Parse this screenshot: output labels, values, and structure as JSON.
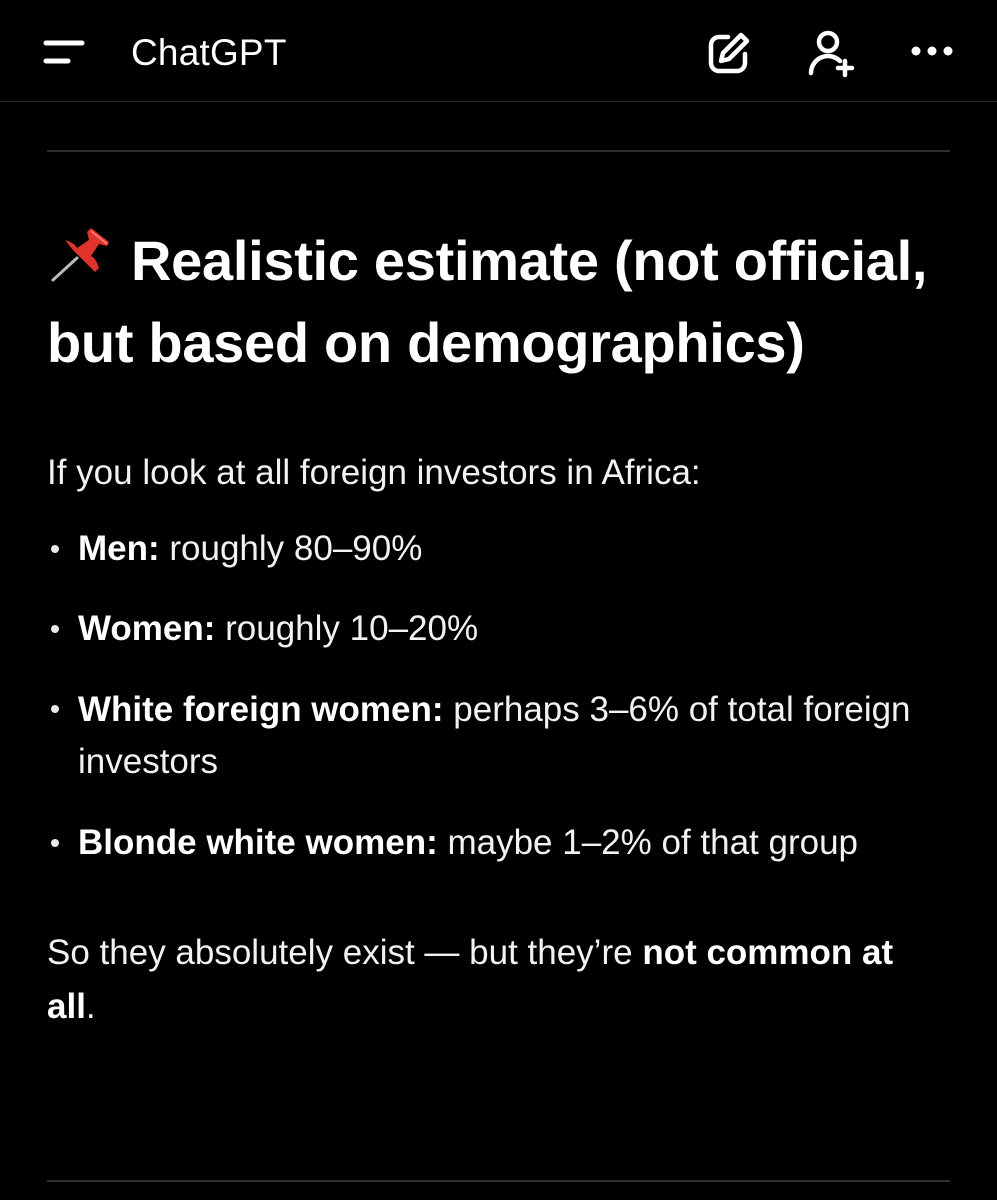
{
  "header": {
    "menu_icon": "hamburger-menu-icon",
    "title": "ChatGPT",
    "new_chat_icon": "edit-icon",
    "add_people_icon": "add-user-icon",
    "more_icon": "more-horizontal-icon"
  },
  "message": {
    "heading_emoji": "pushpin-icon",
    "heading": "Realistic estimate (not official, but based on demographics)",
    "intro": "If you look at all foreign investors in Africa:",
    "bullets": [
      {
        "label": "Men:",
        "text": " roughly 80–90%"
      },
      {
        "label": "Women:",
        "text": " roughly 10–20%"
      },
      {
        "label": "White foreign women:",
        "text": " perhaps 3–6% of total foreign investors"
      },
      {
        "label": "Blonde white women:",
        "text": " maybe 1–2% of that group"
      }
    ],
    "closing_text": "So they absolutely exist — but they’re ",
    "closing_bold": "not common at all",
    "closing_end": "."
  },
  "colors": {
    "background": "#000000",
    "text": "#ffffff",
    "divider": "#2e2e2e",
    "pin_red": "#e0332b"
  }
}
